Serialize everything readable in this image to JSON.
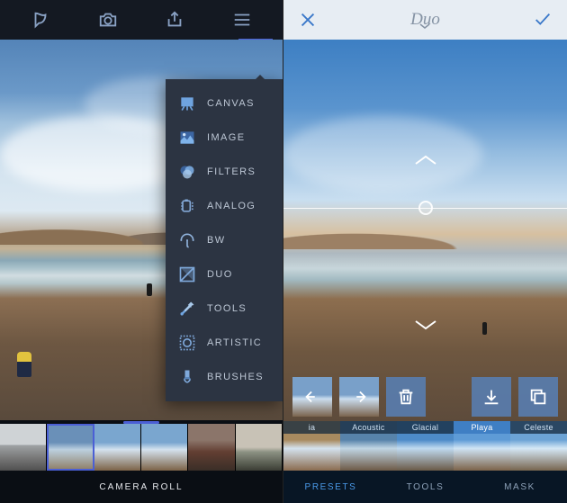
{
  "left": {
    "footer_label": "CAMERA ROLL",
    "menu": [
      {
        "label": "CANVAS",
        "key": "canvas"
      },
      {
        "label": "IMAGE",
        "key": "image"
      },
      {
        "label": "FILTERS",
        "key": "filters"
      },
      {
        "label": "ANALOG",
        "key": "analog"
      },
      {
        "label": "BW",
        "key": "bw"
      },
      {
        "label": "DUO",
        "key": "duo"
      },
      {
        "label": "TOOLS",
        "key": "tools"
      },
      {
        "label": "ARTISTIC",
        "key": "artistic"
      },
      {
        "label": "BRUSHES",
        "key": "brushes"
      }
    ]
  },
  "right": {
    "title": "Duo",
    "tabs": {
      "presets": "PRESETS",
      "tools": "TOOLS",
      "mask": "MASK"
    },
    "presets": [
      {
        "label": "ia"
      },
      {
        "label": "Acoustic"
      },
      {
        "label": "Glacial"
      },
      {
        "label": "Playa"
      },
      {
        "label": "Celeste"
      }
    ]
  }
}
